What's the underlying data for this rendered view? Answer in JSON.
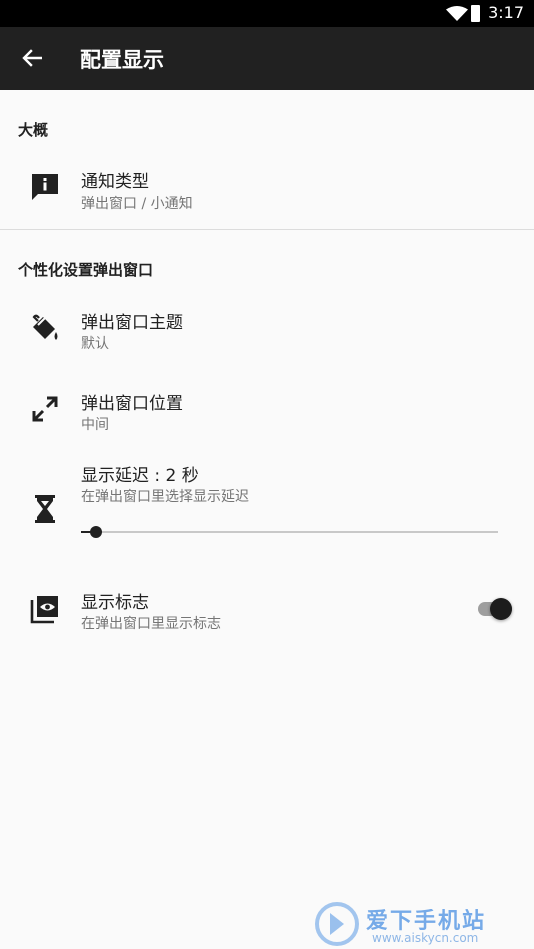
{
  "status_bar": {
    "time": "3:17"
  },
  "app_bar": {
    "title": "配置显示"
  },
  "sections": {
    "general": {
      "title": "大概"
    },
    "custom": {
      "title": "个性化设置弹出窗口"
    }
  },
  "prefs": {
    "notification_type": {
      "title": "通知类型",
      "summary": "弹出窗口 / 小通知",
      "icon": "info-message-icon"
    },
    "popup_theme": {
      "title": "弹出窗口主题",
      "summary": "默认",
      "icon": "paint-bucket-icon"
    },
    "popup_position": {
      "title": "弹出窗口位置",
      "summary": "中间",
      "icon": "expand-arrows-icon"
    },
    "display_delay": {
      "title": "显示延迟 : 2 秒",
      "summary": "在弹出窗口里选择显示延迟",
      "icon": "hourglass-icon",
      "slider_fraction": 0.035
    },
    "show_logo": {
      "title": "显示标志",
      "summary": "在弹出窗口里显示标志",
      "icon": "eye-layers-icon",
      "enabled": true
    }
  },
  "watermark": {
    "name": "爱下手机站",
    "url": "www.aiskycn.com"
  },
  "colors": {
    "app_bar": "#212121",
    "status_bar": "#000000",
    "background": "#fafafa",
    "watermark": "#4a90e2"
  }
}
